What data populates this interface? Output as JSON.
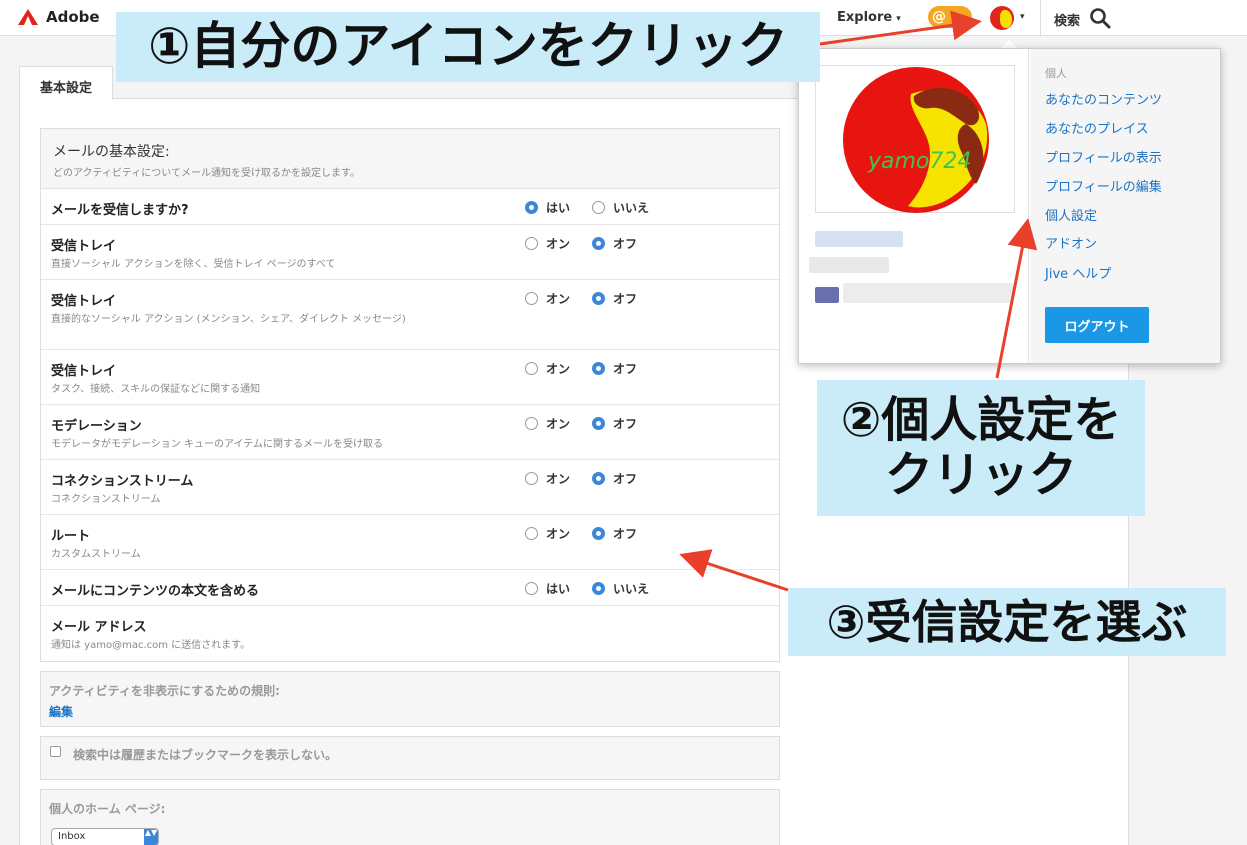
{
  "header": {
    "brand": "Adobe",
    "explore": "Explore",
    "caret": "▾",
    "at_badge": "@",
    "search_label": "検索"
  },
  "tab": {
    "label": "基本設定"
  },
  "mail_settings": {
    "title": "メールの基本設定:",
    "subtitle": "どのアクティビティについてメール通知を受け取るかを設定します。",
    "rows": [
      {
        "label": "メールを受信しますか?",
        "desc": "",
        "opt1": "はい",
        "opt2": "いいえ",
        "selected": 1
      },
      {
        "label": "受信トレイ",
        "desc": "直接ソーシャル アクションを除く、受信トレイ ページのすべて",
        "opt1": "オン",
        "opt2": "オフ",
        "selected": 2
      },
      {
        "label": "受信トレイ",
        "desc": "直接的なソーシャル アクション (メンション、シェア、ダイレクト メッセージ)",
        "opt1": "オン",
        "opt2": "オフ",
        "selected": 2
      },
      {
        "label": "受信トレイ",
        "desc": "タスク、接続、スキルの保証などに関する通知",
        "opt1": "オン",
        "opt2": "オフ",
        "selected": 2
      },
      {
        "label": "モデレーション",
        "desc": "モデレータがモデレーション キューのアイテムに関するメールを受け取る",
        "opt1": "オン",
        "opt2": "オフ",
        "selected": 2
      },
      {
        "label": "コネクションストリーム",
        "desc": "コネクションストリーム",
        "opt1": "オン",
        "opt2": "オフ",
        "selected": 2
      },
      {
        "label": "ルート",
        "desc": "カスタムストリーム",
        "opt1": "オン",
        "opt2": "オフ",
        "selected": 2
      },
      {
        "label": "メールにコンテンツの本文を含める",
        "desc": "",
        "opt1": "はい",
        "opt2": "いいえ",
        "selected": 2
      },
      {
        "label": "メール アドレス",
        "desc": "通知は yamo@mac.com に送信されます。",
        "opt1": "",
        "opt2": "",
        "selected": 0
      }
    ]
  },
  "hide_rules": {
    "title": "アクティビティを非表示にするための規則:",
    "edit": "編集"
  },
  "history": {
    "label": "検索中は履歴またはブックマークを表示しない。",
    "checked": false
  },
  "home_page": {
    "title": "個人のホーム ページ:",
    "selected": "Inbox",
    "select_arrows": "▲▼"
  },
  "dropdown": {
    "section": "個人",
    "avatar_text": "yamo724",
    "links": [
      "あなたのコンテンツ",
      "あなたのプレイス",
      "プロフィールの表示",
      "プロフィールの編集",
      "個人設定",
      "アドオン",
      "Jive ヘルプ"
    ],
    "logout": "ログアウト"
  },
  "annotations": {
    "step1": "①自分のアイコンをクリック",
    "step2_line1": "②個人設定を",
    "step2_line2": "クリック",
    "step3": "③受信設定を選ぶ"
  },
  "colors": {
    "annotation_bg": "#c9ecf8",
    "arrow": "#e8402a",
    "link": "#1a73c7",
    "radio_on": "#3b87d9",
    "logout_button": "#1a98e6"
  }
}
